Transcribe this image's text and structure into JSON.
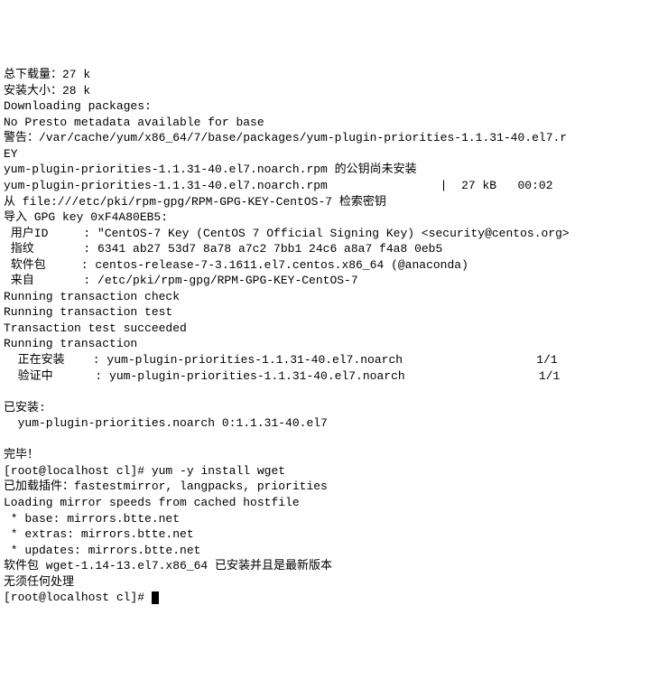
{
  "lines": [
    "总下载量：27 k",
    "安装大小：28 k",
    "Downloading packages:",
    "No Presto metadata available for base",
    "警告：/var/cache/yum/x86_64/7/base/packages/yum-plugin-priorities-1.1.31-40.el7.r",
    "EY",
    "yum-plugin-priorities-1.1.31-40.el7.noarch.rpm 的公钥尚未安装",
    "yum-plugin-priorities-1.1.31-40.el7.noarch.rpm                |  27 kB   00:02",
    "从 file:///etc/pki/rpm-gpg/RPM-GPG-KEY-CentOS-7 检索密钥",
    "导入 GPG key 0xF4A80EB5:",
    " 用户ID     : \"CentOS-7 Key (CentOS 7 Official Signing Key) <security@centos.org>",
    " 指纹       : 6341 ab27 53d7 8a78 a7c2 7bb1 24c6 a8a7 f4a8 0eb5",
    " 软件包     : centos-release-7-3.1611.el7.centos.x86_64 (@anaconda)",
    " 来自       : /etc/pki/rpm-gpg/RPM-GPG-KEY-CentOS-7",
    "Running transaction check",
    "Running transaction test",
    "Transaction test succeeded",
    "Running transaction",
    "  正在安装    : yum-plugin-priorities-1.1.31-40.el7.noarch                   1/1",
    "  验证中      : yum-plugin-priorities-1.1.31-40.el7.noarch                   1/1",
    "",
    "已安装:",
    "  yum-plugin-priorities.noarch 0:1.1.31-40.el7",
    "",
    "完毕！",
    "[root@localhost cl]# yum -y install wget",
    "已加载插件：fastestmirror, langpacks, priorities",
    "Loading mirror speeds from cached hostfile",
    " * base: mirrors.btte.net",
    " * extras: mirrors.btte.net",
    " * updates: mirrors.btte.net",
    "软件包 wget-1.14-13.el7.x86_64 已安装并且是最新版本",
    "无须任何处理"
  ],
  "prompt": "[root@localhost cl]# "
}
